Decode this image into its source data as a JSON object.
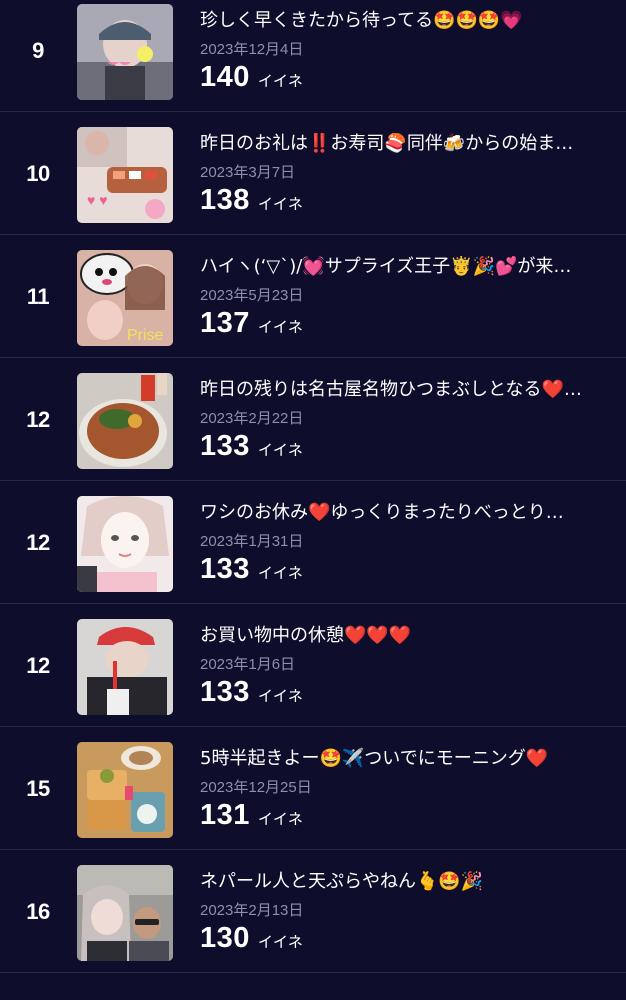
{
  "like_unit": "イイネ",
  "posts": [
    {
      "rank": "9",
      "title": "珍しく早くきたから待ってる🤩🤩🤩💗",
      "date": "2023年12月4日",
      "likes": "140",
      "thumb": "selfie-hat"
    },
    {
      "rank": "10",
      "title": "昨日のお礼は‼️お寿司🍣同伴🍻からの始ま…",
      "date": "2023年3月7日",
      "likes": "138",
      "thumb": "sushi"
    },
    {
      "rank": "11",
      "title": "ハイヽ(‘▽`)/💓サプライズ王子🤴🎉💕が来…",
      "date": "2023年5月23日",
      "likes": "137",
      "thumb": "surprise"
    },
    {
      "rank": "12",
      "title": "昨日の残りは名古屋名物ひつまぶしとなる❤️…",
      "date": "2023年2月22日",
      "likes": "133",
      "thumb": "hitsumabushi"
    },
    {
      "rank": "12",
      "title": "ワシのお休み❤️ゆっくりまったりべっとり…",
      "date": "2023年1月31日",
      "likes": "133",
      "thumb": "selfie-bright"
    },
    {
      "rank": "12",
      "title": "お買い物中の休憩❤️❤️❤️",
      "date": "2023年1月6日",
      "likes": "133",
      "thumb": "cap-drink"
    },
    {
      "rank": "15",
      "title": "5時半起きよー🤩✈️ついでにモーニング❤️",
      "date": "2023年12月25日",
      "likes": "131",
      "thumb": "morning"
    },
    {
      "rank": "16",
      "title": "ネパール人と天ぷらやねん🫰🤩🎉",
      "date": "2023年2月13日",
      "likes": "130",
      "thumb": "two-people"
    }
  ]
}
